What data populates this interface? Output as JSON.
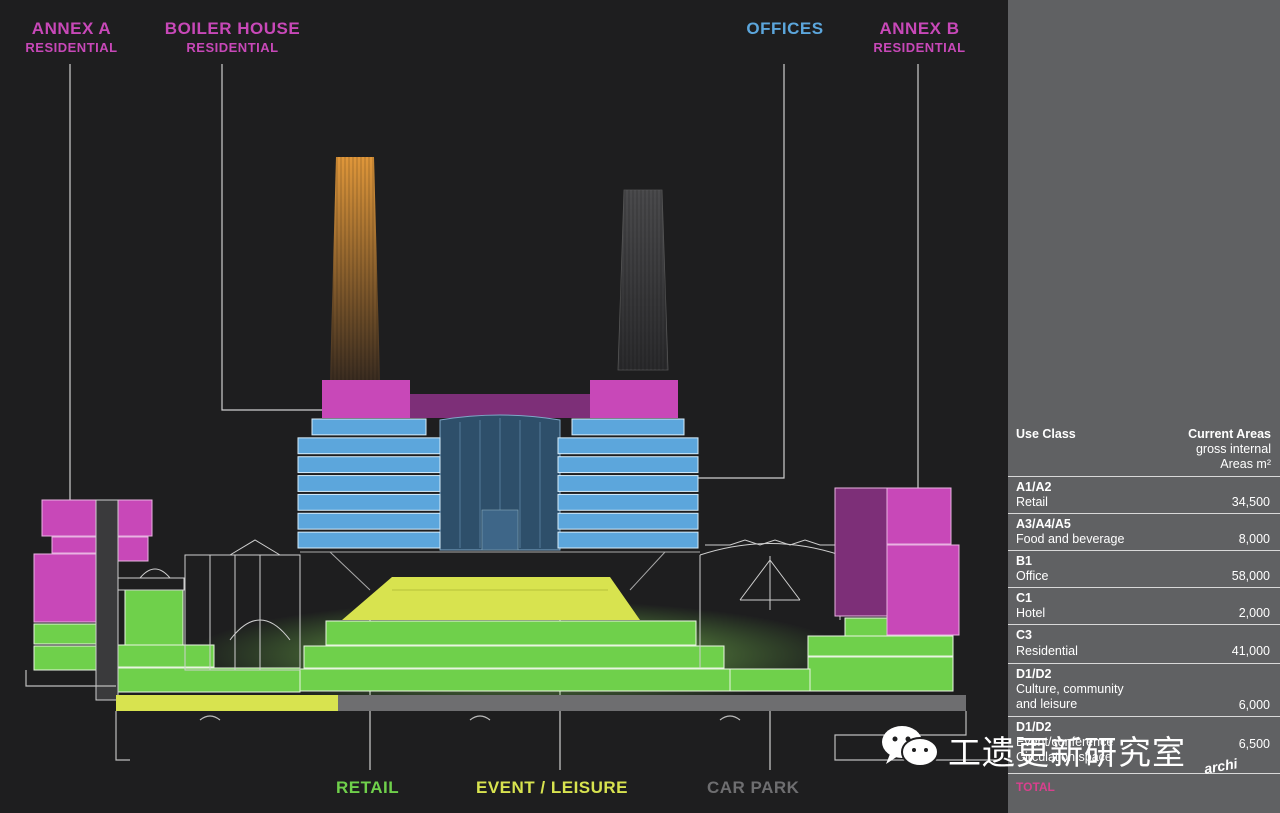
{
  "callouts": {
    "annex_a": {
      "title": "ANNEX A",
      "sub": "RESIDENTIAL"
    },
    "boiler_house": {
      "title": "BOILER HOUSE",
      "sub": "RESIDENTIAL"
    },
    "offices": {
      "title": "OFFICES"
    },
    "annex_b": {
      "title": "ANNEX B",
      "sub": "RESIDENTIAL"
    },
    "retail": "RETAIL",
    "event_leisure": "EVENT / LEISURE",
    "car_park": "CAR PARK"
  },
  "colors": {
    "residential": "#c848b8",
    "offices": "#5ca6dc",
    "retail": "#6fd04b",
    "event_leisure": "#d8e34f",
    "car_park": "#6e6e70",
    "chimney_lit": "#e0973a",
    "total": "#d9408e"
  },
  "table": {
    "header_left": "Use Class",
    "header_right_bold": "Current Areas",
    "header_right_l2": "gross internal",
    "header_right_l3": "Areas m²",
    "rows": [
      {
        "code": "A1/A2",
        "name": "Retail",
        "value": "34,500"
      },
      {
        "code": "A3/A4/A5",
        "name": "Food and beverage",
        "value": "8,000"
      },
      {
        "code": "B1",
        "name": "Office",
        "value": "58,000"
      },
      {
        "code": "C1",
        "name": "Hotel",
        "value": "2,000"
      },
      {
        "code": "C3",
        "name": "Residential",
        "value": "41,000"
      },
      {
        "code": "D1/D2",
        "name_l1": "Culture, community",
        "name_l2": "and leisure",
        "value": "6,000"
      },
      {
        "code": "D1/D2",
        "name_l1": "Event/conference",
        "name_l2": "Circulation space",
        "value": "6,500"
      }
    ],
    "total_label": "TOTAL"
  },
  "watermark": {
    "text": "工遗更新研究室",
    "corner": "archi"
  }
}
